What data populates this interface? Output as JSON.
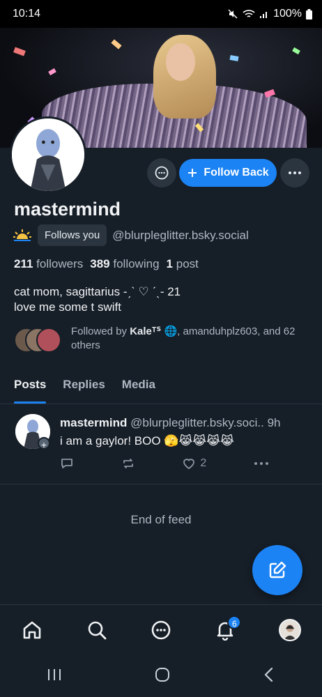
{
  "status_bar": {
    "time": "10:14",
    "battery": "100%"
  },
  "profile": {
    "display_name": "mastermind",
    "follows_you_label": "Follows you",
    "handle": "@blurpleglitter.bsky.social",
    "stats": {
      "followers_count": "211",
      "followers_label": "followers",
      "following_count": "389",
      "following_label": "following",
      "posts_count": "1",
      "posts_label": "post"
    },
    "bio_line1": "cat mom, sagittarius -ˏˋ ♡ ˊˎ- 21",
    "bio_line2": "love me some t swift",
    "followed_by": {
      "prefix": "Followed by ",
      "name": "Kaleᵀᔆ 🌐",
      "suffix": ", amanduhplz603, and 62 others"
    }
  },
  "actions": {
    "follow_back_label": "Follow Back"
  },
  "tabs": [
    {
      "label": "Posts",
      "active": true
    },
    {
      "label": "Replies",
      "active": false
    },
    {
      "label": "Media",
      "active": false
    }
  ],
  "post": {
    "author": "mastermind",
    "handle": "@blurpleglitter.bsky.soci..",
    "time": "9h",
    "text": "i am a gaylor! BOO 🫣😹😹😹😹",
    "like_count": "2"
  },
  "end_of_feed": "End of feed",
  "bottom_nav": {
    "notifications_badge": "6"
  },
  "colors": {
    "background": "#161e27",
    "accent": "#1c83f4",
    "muted_text": "#aeb8c3"
  },
  "icons": [
    "home-icon",
    "search-icon",
    "chat-icon",
    "bell-icon",
    "compose-icon",
    "reply-icon",
    "repost-icon",
    "heart-icon",
    "more-icon"
  ]
}
